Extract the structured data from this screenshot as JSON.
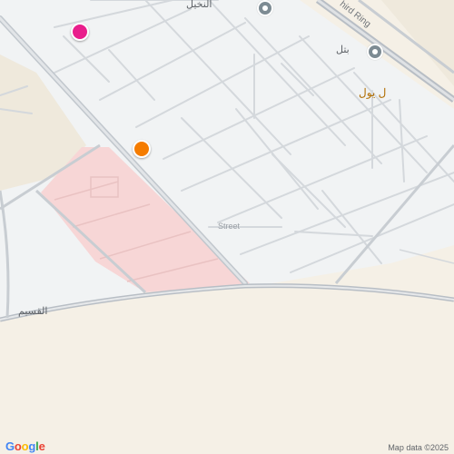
{
  "map": {
    "labels": {
      "third_ring": "hird Ring",
      "top_arabic": "النخيل",
      "right_poi": "بتل",
      "east_poi": "ل يول",
      "street": "Street",
      "bottom_left_arabic": "القسيم"
    },
    "attribution": "Map data ©2025",
    "logo": {
      "letters": [
        "G",
        "o",
        "o",
        "g",
        "l",
        "e"
      ],
      "colors": [
        "#4285F4",
        "#EA4335",
        "#FBBC05",
        "#4285F4",
        "#34A853",
        "#EA4335"
      ]
    },
    "colors": {
      "land": "#f5f0e6",
      "urban": "#f1f3f4",
      "pink_area": "#f7d6d6",
      "road": "#c8cdd2",
      "major_road": "#b8bec5",
      "pin_pink": "#e91e8c",
      "pin_orange": "#f57c00"
    },
    "markers": [
      {
        "name": "pink-pin",
        "color": "#e91e8c"
      },
      {
        "name": "orange-pin",
        "color": "#f57c00"
      }
    ]
  }
}
